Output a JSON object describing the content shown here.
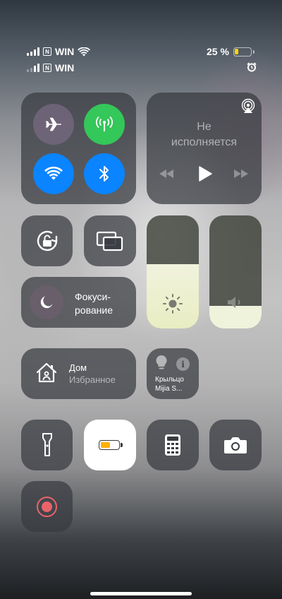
{
  "status_bar": {
    "carrier_primary": "WIN",
    "carrier_secondary": "WIN",
    "sim_badge": "N",
    "battery_percent": "25 %",
    "battery_level": 0.25,
    "icons": [
      "signal-bars-icon",
      "wifi-icon",
      "battery-icon",
      "alarm-icon"
    ]
  },
  "connectivity": {
    "airplane": {
      "icon": "airplane-icon",
      "on": false
    },
    "cellular": {
      "icon": "cellular-antenna-icon",
      "on": true,
      "color": "#34c759"
    },
    "wifi": {
      "icon": "wifi-icon",
      "on": true,
      "color": "#0a84ff"
    },
    "bluetooth": {
      "icon": "bluetooth-icon",
      "on": true,
      "color": "#0a84ff"
    }
  },
  "now_playing": {
    "status_line1": "Не",
    "status_line2": "исполняется",
    "icons": [
      "airplay-icon",
      "rewind-icon",
      "play-icon",
      "fast-forward-icon"
    ]
  },
  "orientation_lock": {
    "icon": "rotation-lock-icon"
  },
  "screen_mirroring": {
    "icon": "screen-mirroring-icon"
  },
  "focus": {
    "label_line1": "Фокуси-",
    "label_line2": "рование",
    "icon": "moon-icon"
  },
  "brightness": {
    "icon": "sun-icon",
    "level": 0.57
  },
  "volume": {
    "icon": "speaker-icon",
    "level": 0.2
  },
  "home": {
    "title": "Дом",
    "subtitle": "Избранное",
    "icon": "house-icon"
  },
  "accessory": {
    "name_line1": "Крыльцо",
    "name_line2": "Mijia S...",
    "icons": [
      "lightbulb-icon",
      "info-icon"
    ]
  },
  "shortcuts": [
    {
      "icon": "flashlight-icon"
    },
    {
      "icon": "low-power-battery-icon",
      "accent": "#ffb000"
    },
    {
      "icon": "calculator-icon"
    },
    {
      "icon": "camera-icon"
    },
    {
      "icon": "screen-record-icon",
      "accent": "#ff3b30"
    }
  ]
}
